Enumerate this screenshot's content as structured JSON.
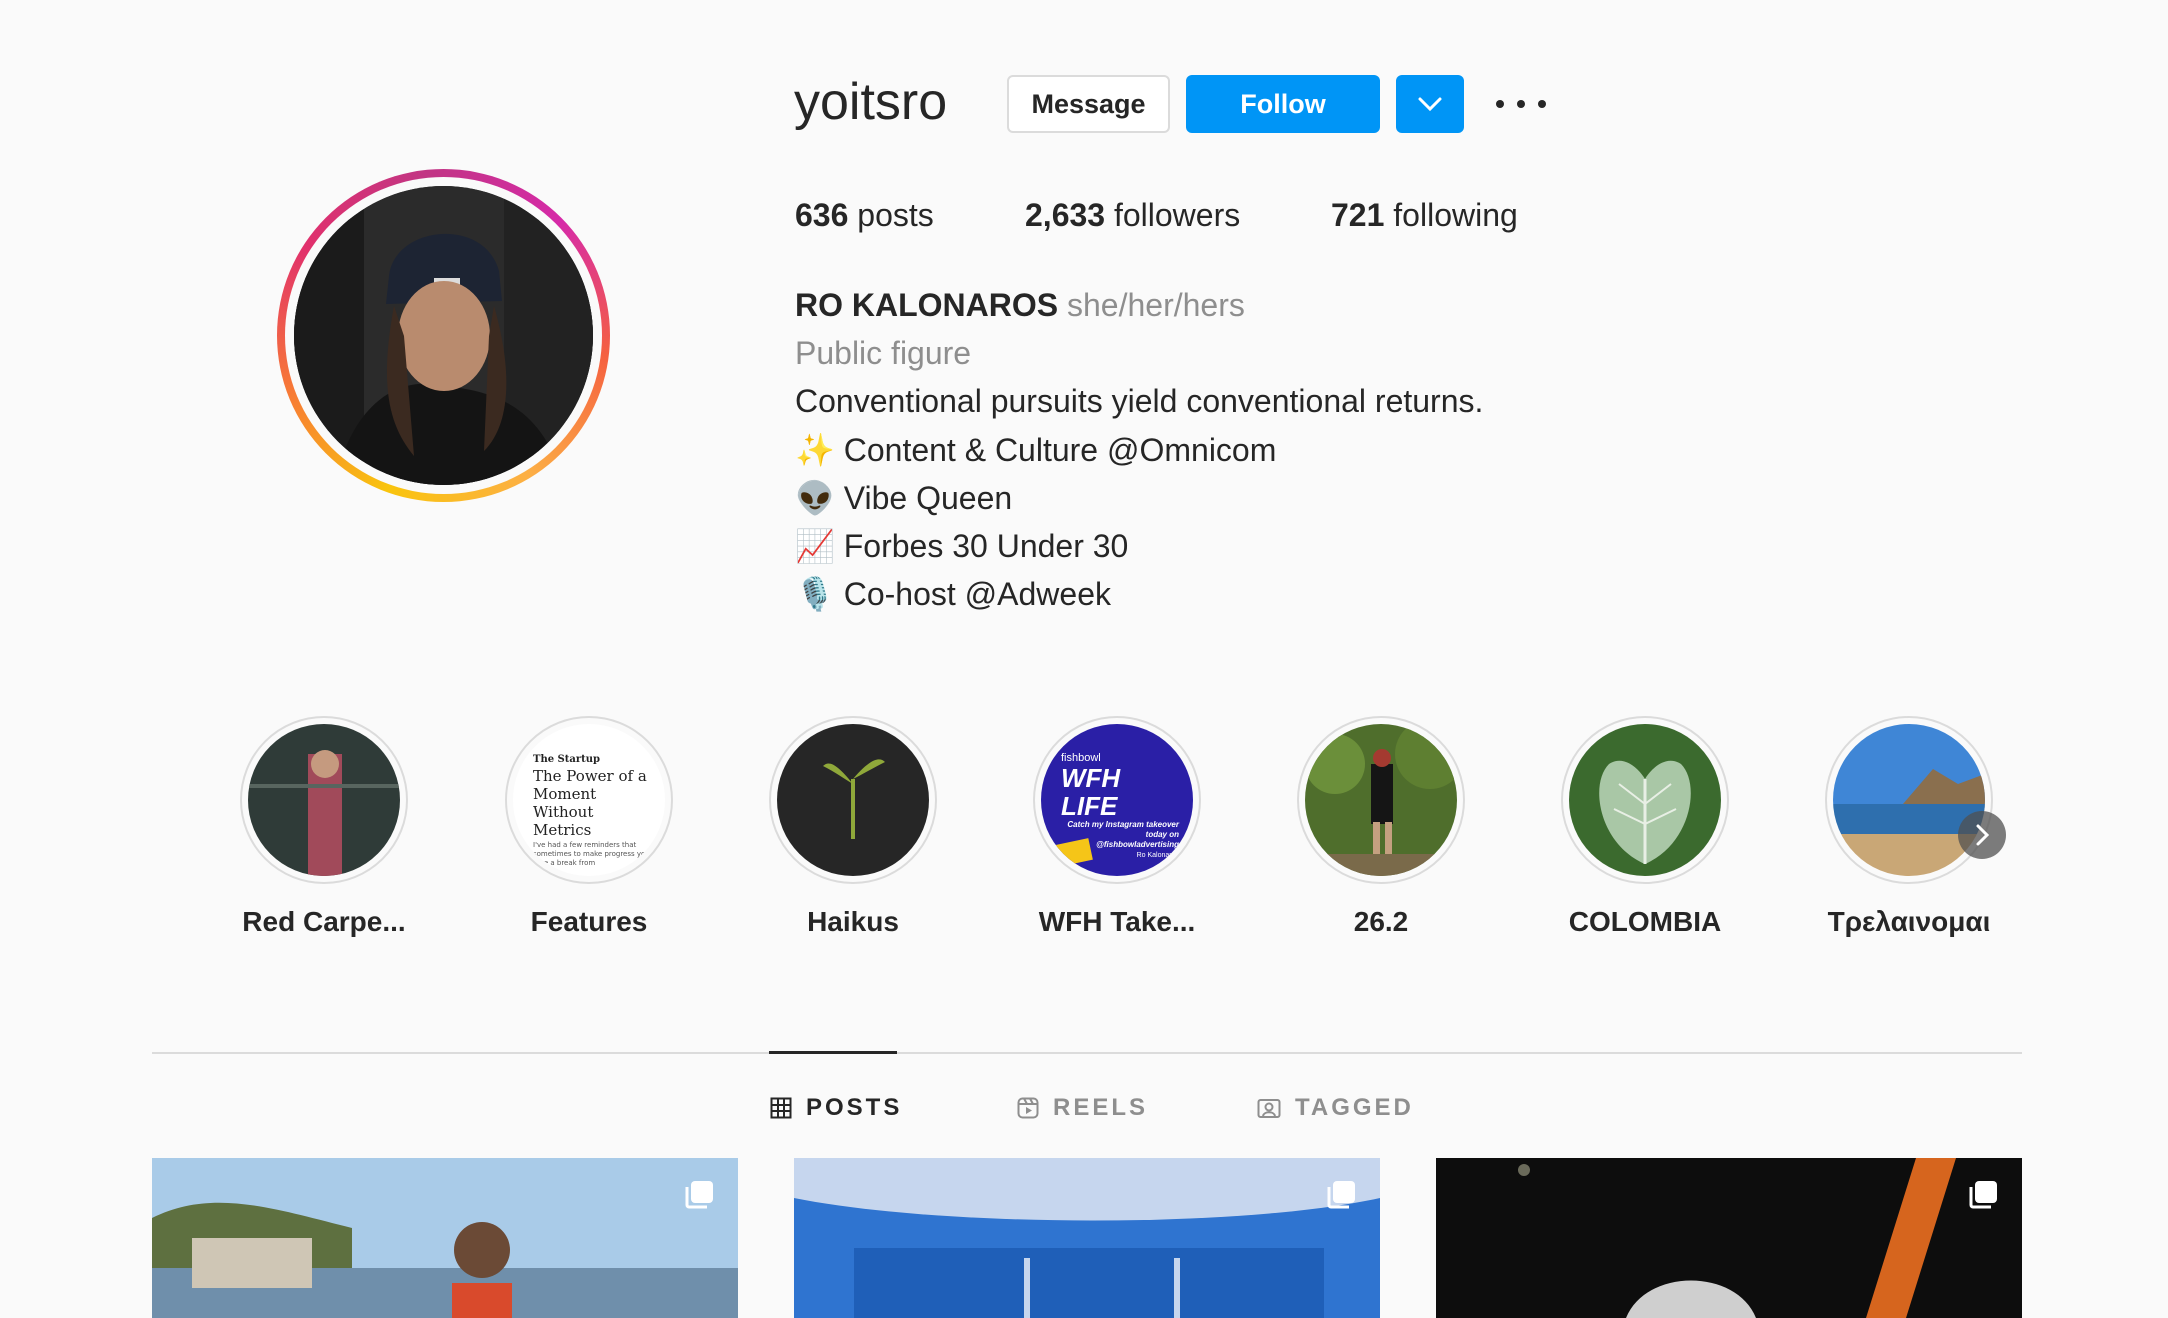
{
  "profile": {
    "username": "yoitsro",
    "buttons": {
      "message": "Message",
      "follow": "Follow"
    },
    "stats": {
      "posts_count": "636",
      "posts_label": "posts",
      "followers_count": "2,633",
      "followers_label": "followers",
      "following_count": "721",
      "following_label": "following"
    },
    "bio": {
      "name": "RO KALONAROS",
      "pronouns": "she/her/hers",
      "category": "Public figure",
      "lines": [
        "Conventional pursuits yield conventional returns.",
        "✨ Content & Culture @Omnicom",
        "👽 Vibe Queen",
        "📈 Forbes 30 Under 30",
        "🎙️ Co-host @Adweek"
      ]
    }
  },
  "highlights": [
    {
      "label": "Red Carpe..."
    },
    {
      "label": "Features",
      "thumb_text": {
        "brand": "The Startup",
        "title": "The Power of a Moment Without Metrics",
        "snippet": "I've had a few reminders that sometimes to make progress you take a break from"
      }
    },
    {
      "label": "Haikus"
    },
    {
      "label": "WFH Take...",
      "thumb_text": {
        "brand": "fishbowl",
        "title": "WFH LIFE",
        "tagline": "Catch my Instagram takeover today on @fishbowladvertising",
        "name": "Ro Kalonaros"
      }
    },
    {
      "label": "26.2"
    },
    {
      "label": "COLOMBIA"
    },
    {
      "label": "Τρελαινομαι"
    }
  ],
  "tabs": [
    {
      "label": "POSTS",
      "icon": "grid-icon",
      "active": true
    },
    {
      "label": "REELS",
      "icon": "reels-icon",
      "active": false
    },
    {
      "label": "TAGGED",
      "icon": "tagged-icon",
      "active": false
    }
  ],
  "colors": {
    "accent": "#0095f6",
    "text": "#262626",
    "muted": "#8e8e8e",
    "border": "#dbdbdb"
  }
}
